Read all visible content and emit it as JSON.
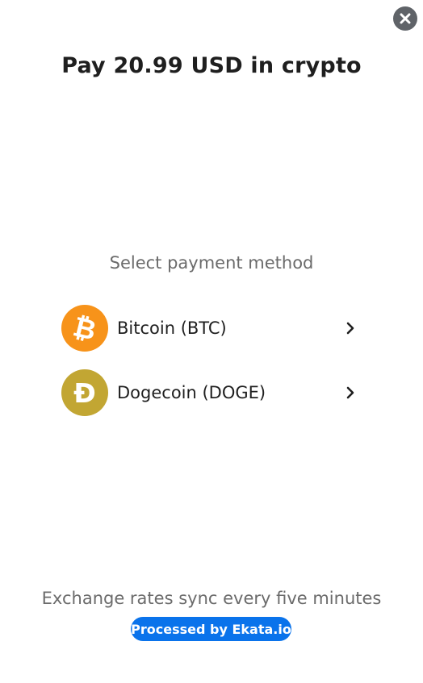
{
  "header": {
    "title": "Pay 20.99 USD in crypto",
    "close_icon": "close-icon"
  },
  "main": {
    "subtitle": "Select payment method",
    "methods": [
      {
        "label": "Bitcoin (BTC)",
        "icon": "bitcoin-icon",
        "color": "#f7931a"
      },
      {
        "label": "Dogecoin (DOGE)",
        "icon": "dogecoin-icon",
        "color": "#c2a633"
      }
    ]
  },
  "footer": {
    "note": "Exchange rates sync every five minutes",
    "badge": "Processed by Ekata.io",
    "badge_color": "#0a73eb"
  }
}
